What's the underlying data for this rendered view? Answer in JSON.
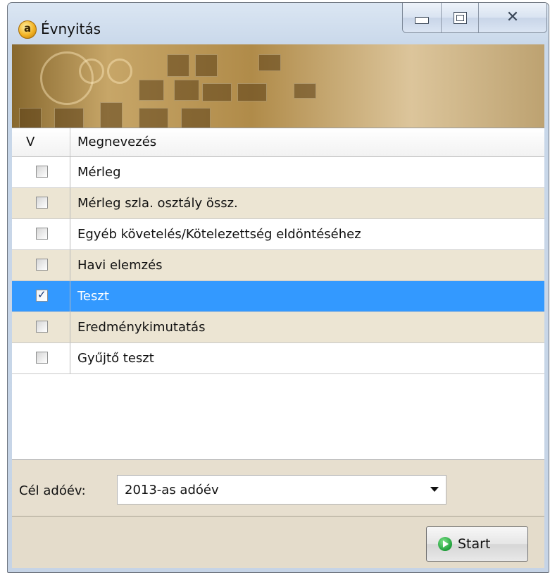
{
  "window": {
    "title": "Évnyitás"
  },
  "grid": {
    "columns": [
      "V",
      "Megnevezés"
    ],
    "rows": [
      {
        "name": "Mérleg",
        "checked": false,
        "selected": false
      },
      {
        "name": "Mérleg szla. osztály össz.",
        "checked": false,
        "selected": false
      },
      {
        "name": "Egyéb követelés/Kötelezettség eldöntéséhez",
        "checked": false,
        "selected": false
      },
      {
        "name": "Havi elemzés",
        "checked": false,
        "selected": false
      },
      {
        "name": "Teszt",
        "checked": true,
        "selected": true
      },
      {
        "name": "Eredménykimutatás",
        "checked": false,
        "selected": false
      },
      {
        "name": "Gyűjtő teszt",
        "checked": false,
        "selected": false
      }
    ]
  },
  "target_year": {
    "label": "Cél adóév:",
    "value": "2013-as adóév"
  },
  "actions": {
    "start_label": "Start"
  },
  "colors": {
    "selected_row": "#3399ff",
    "alt_row": "#ece5d3",
    "panel": "#e7dfcf"
  }
}
